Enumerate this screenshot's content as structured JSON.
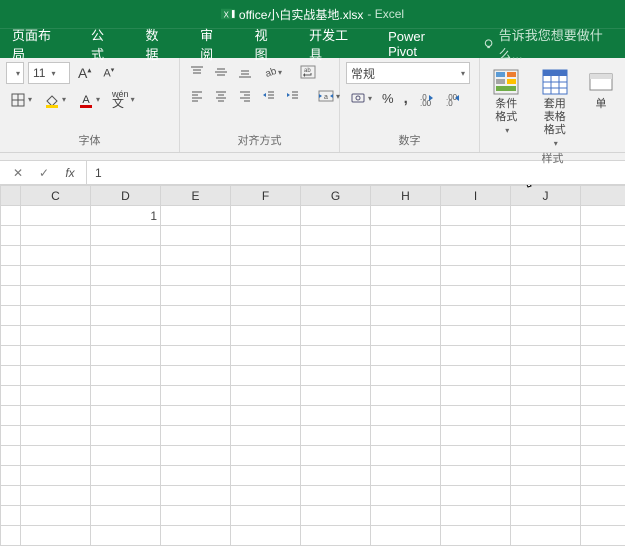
{
  "title": {
    "filename": "office小白实战基地.xlsx",
    "app": "Excel"
  },
  "tabs": [
    "页面布局",
    "公式",
    "数据",
    "审阅",
    "视图",
    "开发工具",
    "Power Pivot"
  ],
  "tell_me": "告诉我您想要做什么...",
  "font": {
    "size": "11",
    "incA": "A",
    "asian": "wén",
    "borders": "",
    "group_label": "字体"
  },
  "align": {
    "group_label": "对齐方式"
  },
  "number": {
    "format": "常规",
    "group_label": "数字",
    "pct": "%",
    "comma": ","
  },
  "styles": {
    "cond": "条件格式",
    "tbl": "套用\n表格格式",
    "cell": "单",
    "group_label": "样式"
  },
  "fx": {
    "value": "1"
  },
  "columns": [
    "",
    "C",
    "D",
    "E",
    "F",
    "G",
    "H",
    "I",
    "J",
    ""
  ],
  "cells": {
    "D_r1": "1"
  },
  "chart_data": {
    "type": "table",
    "columns": [
      "C",
      "D",
      "E",
      "F",
      "G",
      "H",
      "I",
      "J"
    ],
    "rows": [
      {
        "D": 1
      }
    ]
  }
}
